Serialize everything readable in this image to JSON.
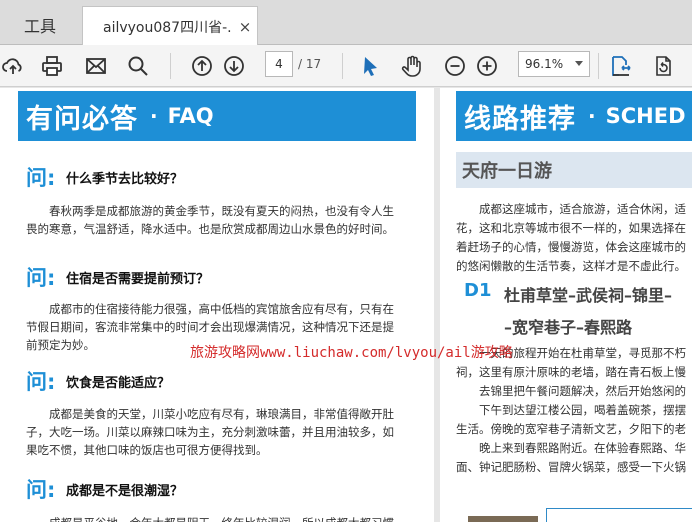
{
  "tabs": {
    "tools_label": "工具",
    "doc_title": "ailvyou087四川省-...",
    "close_glyph": "×"
  },
  "toolbar": {
    "page_current": "4",
    "page_total": "/ 17",
    "zoom": "96.1%",
    "icons": [
      "upload-cloud-icon",
      "print-icon",
      "mail-icon",
      "search-icon",
      "page-up-icon",
      "page-down-icon",
      "select-cursor-icon",
      "hand-tool-icon",
      "zoom-out-icon",
      "zoom-in-icon",
      "fit-page-icon",
      "rotate-page-icon"
    ]
  },
  "faq": {
    "title_cn": "有问必答",
    "title_dot": "·",
    "title_en": "FAQ",
    "q_mark": "问:",
    "items": [
      {
        "q": "什么季节去比较好？",
        "lines": [
          "春秋两季是成都旅游的黄金季节，既没有夏天的闷热，也没有令人生",
          "畏的寒意，气温舒适，降水适中。也是欣赏成都周边山水景色的好时间。"
        ]
      },
      {
        "q": "住宿是否需要提前预订？",
        "lines": [
          "成都市的住宿接待能力很强，高中低档的宾馆旅舍应有尽有，只有在",
          "节假日期间，客流非常集中的时间才会出现爆满情况，这种情况下还是提",
          "前预定为妙。"
        ]
      },
      {
        "q": "饮食是否能适应？",
        "lines": [
          "成都是美食的天堂，川菜小吃应有尽有，琳琅满目，非常值得敞开肚",
          "子，大吃一场。川菜以麻辣口味为主，充分刺激味蕾，并且用油较多，如",
          "果吃不惯，其他口味的饭店也可很方便得找到。"
        ]
      },
      {
        "q": "成都是不是很潮湿？",
        "lines": [
          "成都是平谷地，会年大都是阴天，终年比较湿润，所以成都大都习惯"
        ]
      }
    ]
  },
  "route": {
    "title_cn": "线路推荐",
    "title_dot": "·",
    "title_en": "SCHED",
    "sub_title": "天府一日游",
    "intro": [
      "成都这座城市，适合旅游，适合休闲，适",
      "花，这和北京等城市很不一样的，如果选择在",
      "着赶场子的心情，慢慢游览，体会这座城市的",
      "的悠闲懒散的生活节奏，这样才是不虚此行。"
    ],
    "day_label": "D1",
    "route_line1": "杜甫草堂–武侯祠–锦里–",
    "route_line2": "–宽窄巷子–春熙路",
    "day_text": [
      "一天的旅程开始在杜甫草堂，寻觅那不朽",
      "祠，这里有原汁原味的老墙，踏在青石板上慢",
      "去锦里把午餐问题解决，然后开始悠闲的",
      "下午到达望江楼公园，喝着盖碗茶，摆摆",
      "生活。傍晚的宽窄巷子清新文艺，夕阳下的老",
      "晚上来到春熙路附近。在体验春熙路、华",
      "面、钟记肥肠粉、冒牌火锅菜，感受一下火锅"
    ]
  },
  "watermark": {
    "cn": "旅游攻略网",
    "url": "www.liuchaw.com/lvyou/ail",
    "tail": "游攻略"
  }
}
